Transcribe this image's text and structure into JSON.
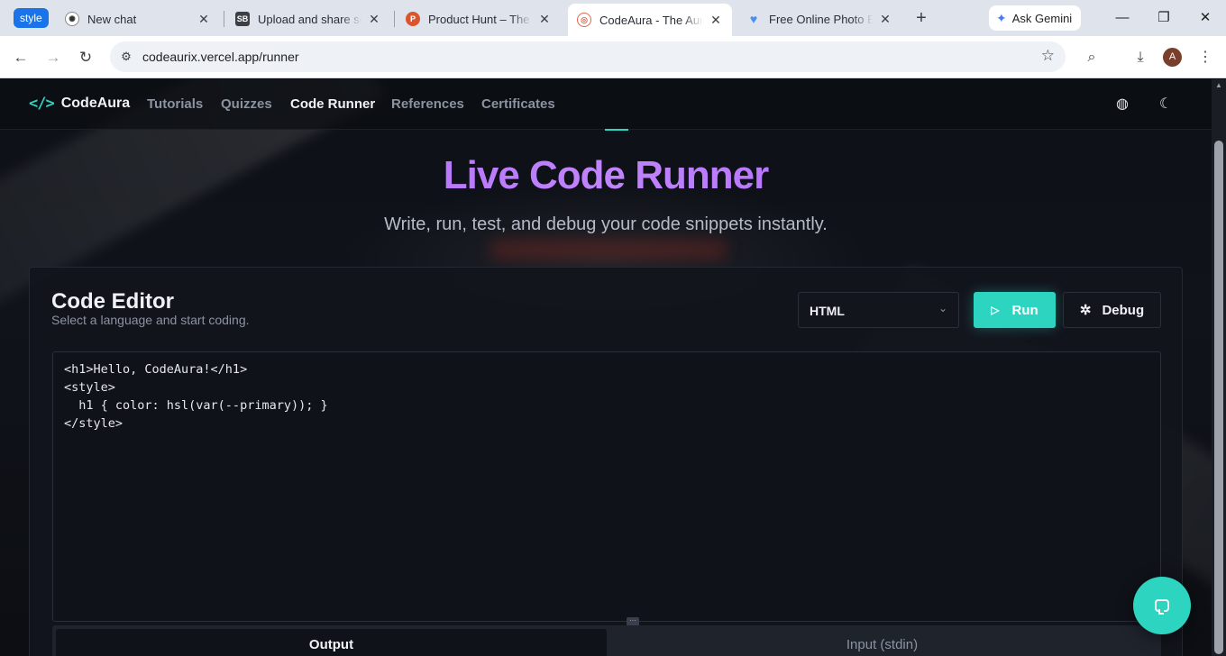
{
  "browser": {
    "tab_group_label": "style",
    "tabs": [
      {
        "title": "New chat",
        "icon": "openai-icon"
      },
      {
        "title": "Upload and share scre",
        "icon": "sb-icon"
      },
      {
        "title": "Product Hunt – The be",
        "icon": "producthunt-icon"
      },
      {
        "title": "CodeAura - The Aura o",
        "icon": "codeaura-icon",
        "active": true
      },
      {
        "title": "Free Online Photo Edit",
        "icon": "heart-icon"
      }
    ],
    "new_tab_symbol": "+",
    "gemini_label": "Ask Gemini",
    "url": "codeaurix.vercel.app/runner",
    "profile_initial": "A"
  },
  "site": {
    "brand": "CodeAura",
    "nav": [
      "Tutorials",
      "Quizzes",
      "Code Runner",
      "References",
      "Certificates"
    ],
    "active_nav": "Code Runner",
    "accent": "#2dd4bf",
    "title_gradient": [
      "#a855f7",
      "#c084fc"
    ]
  },
  "hero": {
    "title": "Live Code Runner",
    "subtitle": "Write, run, test, and debug your code snippets instantly."
  },
  "editor_card": {
    "title": "Code Editor",
    "description": "Select a language and start coding.",
    "language": "HTML",
    "run_label": "Run",
    "debug_label": "Debug",
    "code": "<h1>Hello, CodeAura!</h1>\n<style>\n  h1 { color: hsl(var(--primary)); }\n</style>",
    "tabs": {
      "output": "Output",
      "input": "Input (stdin)"
    }
  }
}
